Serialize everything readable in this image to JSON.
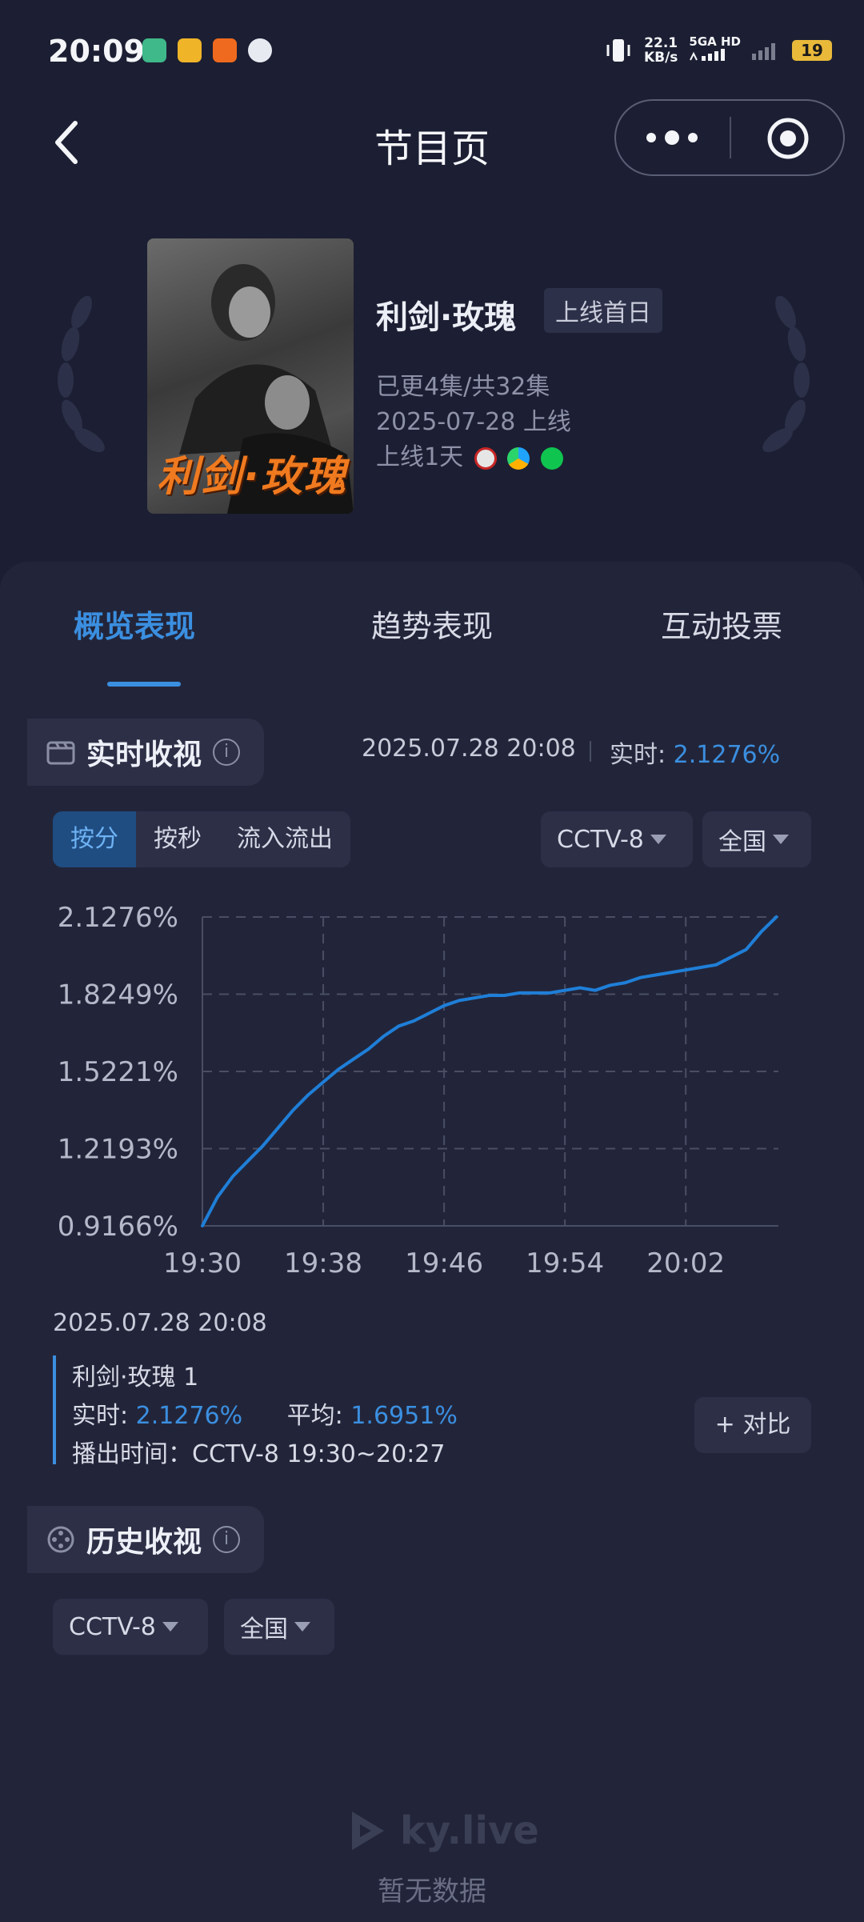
{
  "status_bar": {
    "time": "20:09",
    "net_speed_value": "22.1",
    "net_speed_unit": "KB/s",
    "network": "5GA HD",
    "battery": "19"
  },
  "header": {
    "title": "节目页",
    "icons": [
      "back-arrow-icon",
      "more-dots-icon",
      "record-target-icon"
    ]
  },
  "show": {
    "title": "利剑·玫瑰",
    "poster_text": "利剑·玫瑰",
    "tag": "上线首日",
    "episodes": "已更4集/共32集",
    "premiere": "2025-07-28 上线",
    "online_days": "上线1天",
    "platforms": [
      "cctv8",
      "tencent-video",
      "iqiyi"
    ]
  },
  "tabs": [
    {
      "label": "概览表现",
      "active": true
    },
    {
      "label": "趋势表现",
      "active": false
    },
    {
      "label": "互动投票",
      "active": false
    }
  ],
  "realtime": {
    "section_title": "实时收视",
    "timestamp": "2025.07.28 20:08",
    "realtime_label": "实时:",
    "realtime_value": "2.1276%",
    "segments": [
      "按分",
      "按秒",
      "流入流出"
    ],
    "channel": "CCTV-8",
    "region": "全国"
  },
  "chart_data": {
    "type": "line",
    "title": "",
    "xlabel": "",
    "ylabel": "",
    "x_ticks": [
      "19:30",
      "19:38",
      "19:46",
      "19:54",
      "20:02"
    ],
    "y_ticks": [
      "0.9166%",
      "1.2193%",
      "1.5221%",
      "1.8249%",
      "2.1276%"
    ],
    "ylim": [
      0.9166,
      2.1276
    ],
    "xlim_minutes_from_1930": [
      0,
      38
    ],
    "grid": true,
    "series": [
      {
        "name": "利剑·玫瑰 1",
        "color": "#1f7fd8",
        "points": [
          [
            0,
            0.917
          ],
          [
            1,
            1.03
          ],
          [
            2,
            1.11
          ],
          [
            3,
            1.17
          ],
          [
            4,
            1.23
          ],
          [
            5,
            1.3
          ],
          [
            6,
            1.37
          ],
          [
            7,
            1.43
          ],
          [
            8,
            1.48
          ],
          [
            9,
            1.53
          ],
          [
            10,
            1.57
          ],
          [
            11,
            1.61
          ],
          [
            12,
            1.66
          ],
          [
            13,
            1.7
          ],
          [
            14,
            1.72
          ],
          [
            15,
            1.75
          ],
          [
            16,
            1.78
          ],
          [
            17,
            1.8
          ],
          [
            18,
            1.81
          ],
          [
            19,
            1.82
          ],
          [
            20,
            1.82
          ],
          [
            21,
            1.83
          ],
          [
            22,
            1.83
          ],
          [
            23,
            1.83
          ],
          [
            24,
            1.84
          ],
          [
            25,
            1.85
          ],
          [
            26,
            1.84
          ],
          [
            27,
            1.86
          ],
          [
            28,
            1.87
          ],
          [
            29,
            1.89
          ],
          [
            30,
            1.9
          ],
          [
            31,
            1.91
          ],
          [
            32,
            1.92
          ],
          [
            33,
            1.93
          ],
          [
            34,
            1.94
          ],
          [
            35,
            1.97
          ],
          [
            36,
            2.0
          ],
          [
            37,
            2.07
          ],
          [
            38,
            2.128
          ]
        ]
      }
    ]
  },
  "detail": {
    "date": "2025.07.28 20:08",
    "name": "利剑·玫瑰 1",
    "realtime_label": "实时:",
    "realtime_value": "2.1276%",
    "average_label": "平均:",
    "average_value": "1.6951%",
    "airtime": "播出时间：CCTV-8 19:30~20:27",
    "compare_button": "+ 对比"
  },
  "history": {
    "section_title": "历史收视",
    "channel": "CCTV-8",
    "region": "全国",
    "watermark": "ky.live",
    "empty_text": "暂无数据"
  },
  "colors": {
    "background": "#1c1f33",
    "card": "#22253a",
    "accent": "#3b8fe0",
    "poster_title": "#f07a1f"
  }
}
